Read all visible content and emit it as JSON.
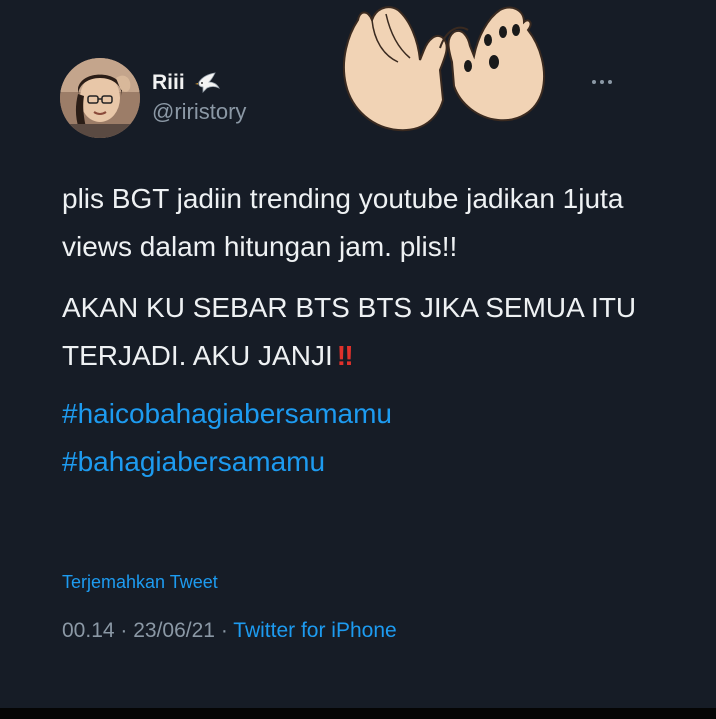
{
  "tweet": {
    "display_name": "Riii",
    "display_name_emoji": "🕊",
    "handle": "@riristory",
    "more_label": "···",
    "paragraph1": "plis BGT jadiin trending youtube jadikan 1juta views dalam hitungan jam. plis!!",
    "paragraph2": "AKAN KU SEBAR BTS BTS JIKA SEMUA ITU TERJADI. AKU JANJI",
    "paragraph2_emoji": "‼",
    "hashtags": [
      "#haicobahagiabersamamu",
      "#bahagiabersamamu"
    ],
    "translate_label": "Terjemahkan Tweet",
    "time": "00.14",
    "separator": " · ",
    "date": "23/06/21",
    "source": "Twitter for iPhone"
  },
  "colors": {
    "background": "#161c26",
    "text": "#eef1f3",
    "muted": "#8b98a5",
    "link": "#1d9bf0",
    "emoji_red": "#e0312b"
  },
  "icons": {
    "overlay": "pinky-promise-hands-icon",
    "verified": "dove-icon",
    "more": "more-dots-icon"
  }
}
